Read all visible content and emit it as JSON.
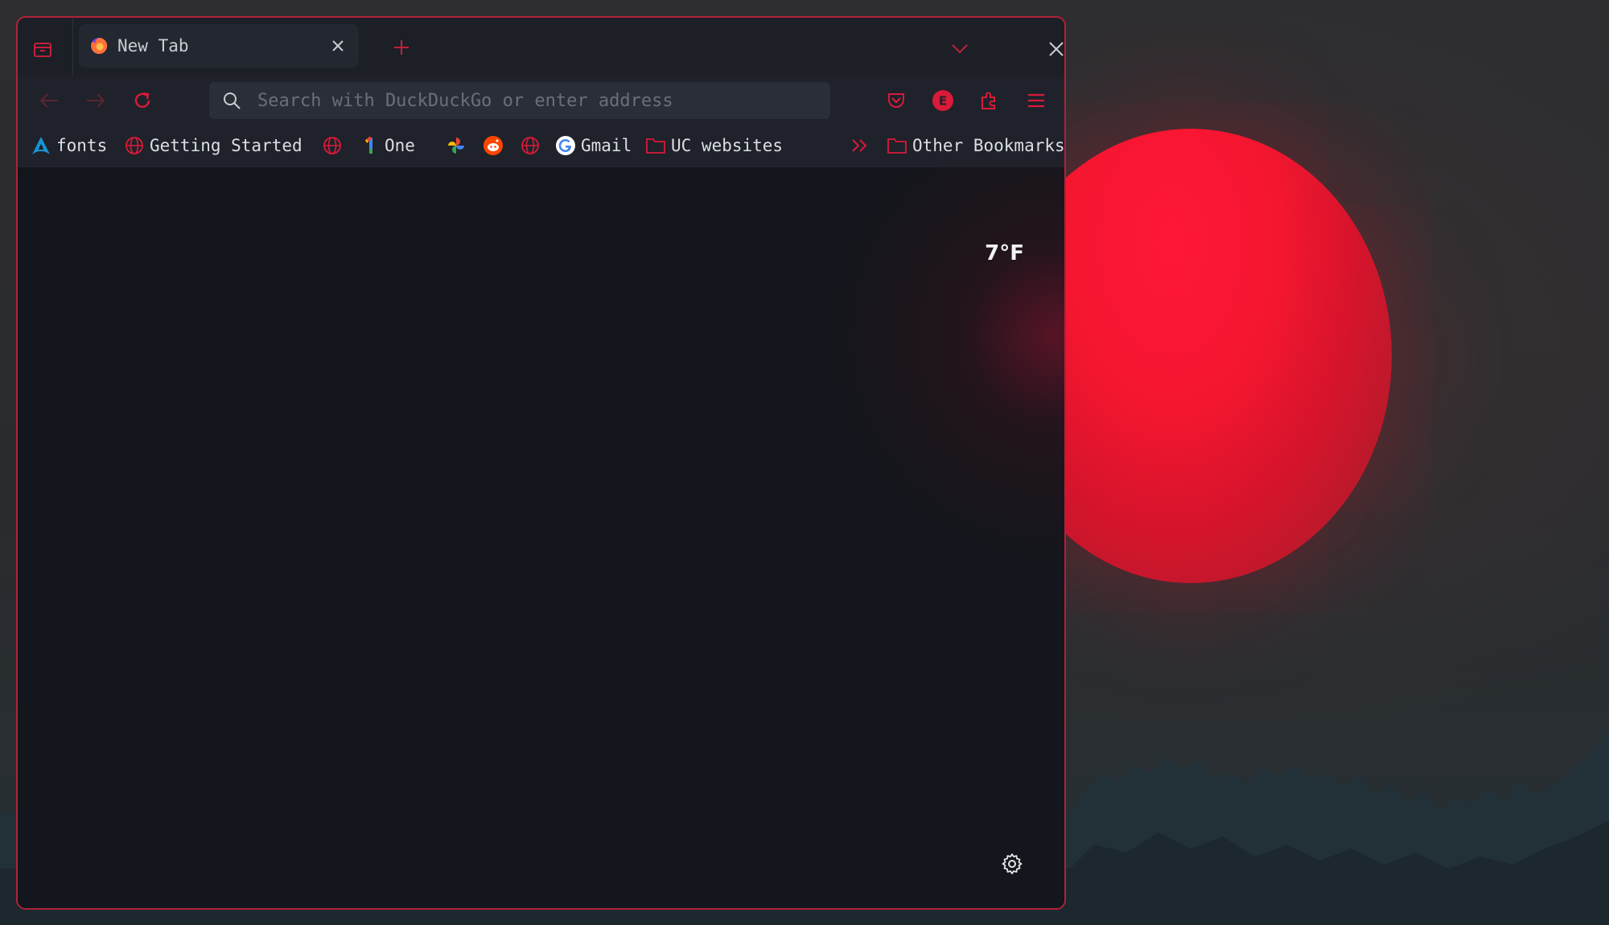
{
  "colors": {
    "accent": "#d91a3a",
    "window_border": "#b0223a",
    "toolbar_bg": "#1f222a",
    "content_bg": "#13161c"
  },
  "tab": {
    "title": "New Tab",
    "favicon": "firefox-icon"
  },
  "navbar": {
    "search_placeholder": "Search with DuckDuckGo or enter address",
    "account_initial": "E"
  },
  "bookmarks": {
    "items": [
      {
        "label": "fonts",
        "icon": "arch-linux-icon"
      },
      {
        "label": "Getting Started",
        "icon": "globe-icon"
      },
      {
        "label": "",
        "icon": "globe-icon"
      },
      {
        "label": "One",
        "icon": "one-icon"
      },
      {
        "label": "",
        "icon": "pinwheel-icon"
      },
      {
        "label": "",
        "icon": "reddit-icon"
      },
      {
        "label": "",
        "icon": "globe-icon"
      },
      {
        "label": "Gmail",
        "icon": "google-icon"
      },
      {
        "label": "UC websites",
        "icon": "folder-icon"
      }
    ],
    "other_label": "Other Bookmarks"
  },
  "newtab_page": {
    "weather_temp": "7°F"
  }
}
